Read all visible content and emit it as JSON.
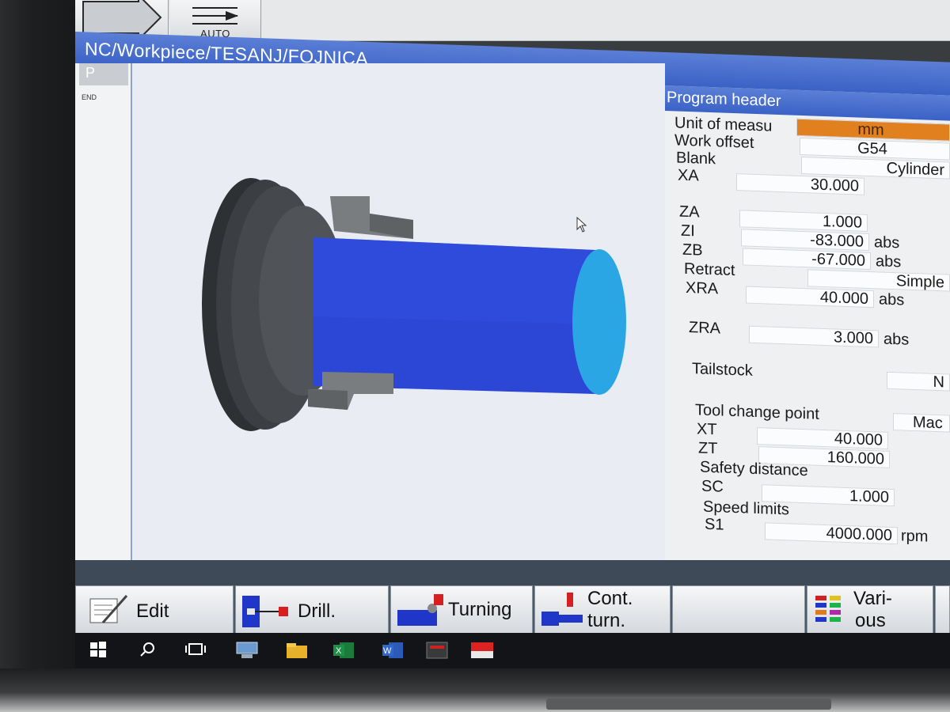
{
  "toolbar": {
    "auto_label": "AUTO"
  },
  "path": "NC/Workpiece/TESANJ/FOJNICA",
  "program_column": {
    "tab": "P",
    "end_label": "END"
  },
  "panel": {
    "title": "Program header",
    "rows": {
      "unit": {
        "label": "Unit of measu",
        "value": "mm"
      },
      "work_offset": {
        "label": "Work offset",
        "value": "G54"
      },
      "blank": {
        "label": "Blank",
        "value": "Cylinder"
      },
      "xa": {
        "label": "XA",
        "value": "30.000"
      },
      "za": {
        "label": "ZA",
        "value": "1.000"
      },
      "zi": {
        "label": "ZI",
        "value": "-83.000",
        "unit": "abs"
      },
      "zb": {
        "label": "ZB",
        "value": "-67.000",
        "unit": "abs"
      },
      "retract": {
        "label": "Retract",
        "value": "Simple"
      },
      "xra": {
        "label": "XRA",
        "value": "40.000",
        "unit": "abs"
      },
      "zra": {
        "label": "ZRA",
        "value": "3.000",
        "unit": "abs"
      },
      "tailstock": {
        "label": "Tailstock",
        "value": "N"
      },
      "tool_change": {
        "label": "Tool change point",
        "value": "Mac"
      },
      "xt": {
        "label": "XT",
        "value": "40.000"
      },
      "zt": {
        "label": "ZT",
        "value": "160.000"
      },
      "safety": {
        "label": "Safety distance"
      },
      "sc": {
        "label": "SC",
        "value": "1.000"
      },
      "speed": {
        "label": "Speed limits"
      },
      "s1": {
        "label": "S1",
        "value": "4000.000",
        "unit": "rpm"
      }
    }
  },
  "softkeys": {
    "edit": "Edit",
    "drill": "Drill.",
    "turning": "Turning",
    "cont_turn_1": "Cont.",
    "cont_turn_2": "turn.",
    "various_1": "Vari-",
    "various_2": "ous"
  },
  "colors": {
    "header_blue": "#3a62c6",
    "workpiece_blue": "#2c46d6",
    "workpiece_face": "#2aa6e4",
    "highlight_orange": "#e0801f"
  },
  "taskbar_icons": [
    "windows-icon",
    "search-icon",
    "task-view-icon",
    "network-icon",
    "file-explorer-icon",
    "excel-icon",
    "word-icon",
    "app-icon",
    "sinumerik-icon"
  ]
}
